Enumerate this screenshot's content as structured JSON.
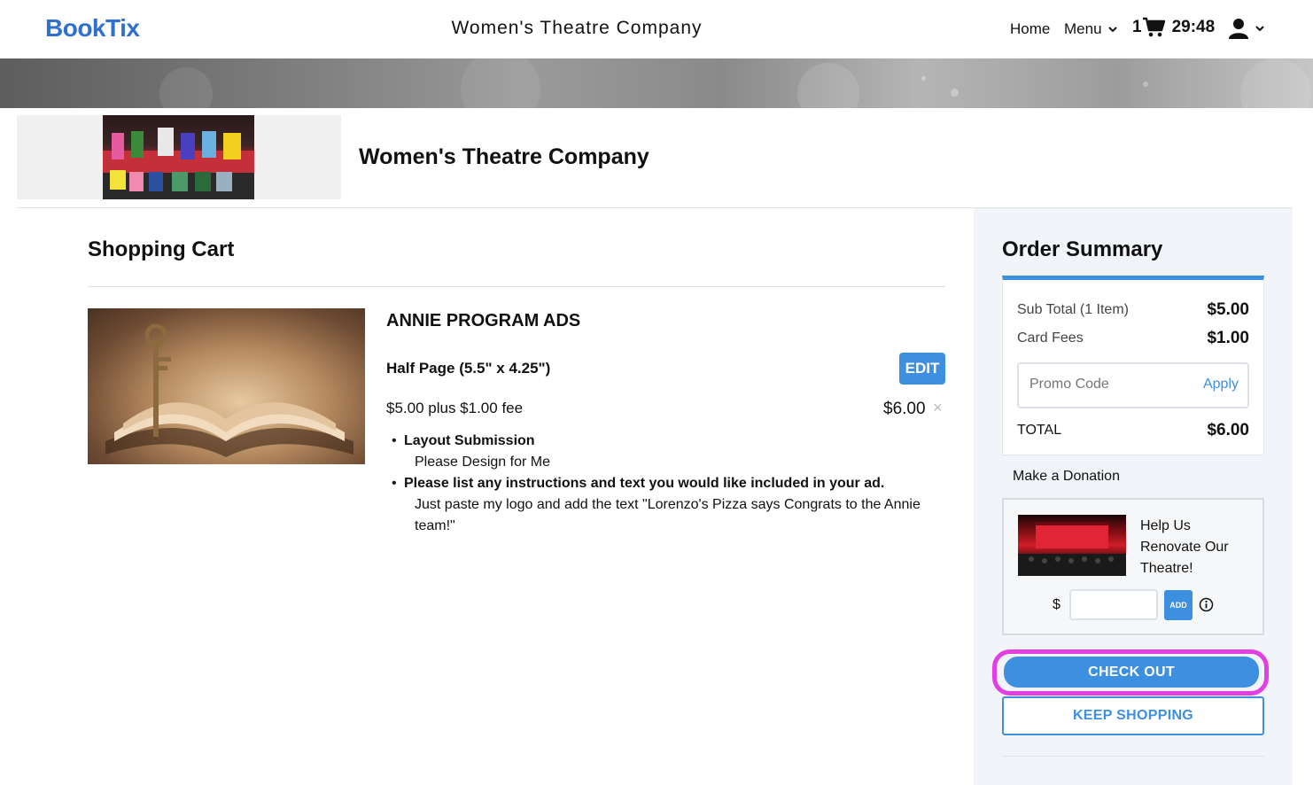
{
  "nav": {
    "logo": "BookTix",
    "title": "Women's Theatre Company",
    "home": "Home",
    "menu": "Menu",
    "cart_count": "1",
    "timer": "29:48"
  },
  "venue": {
    "name": "Women's Theatre Company"
  },
  "cart": {
    "title": "Shopping Cart",
    "item": {
      "name": "ANNIE PROGRAM ADS",
      "variant": "Half Page (5.5\" x 4.25\")",
      "edit_label": "EDIT",
      "price_desc": "$5.00 plus $1.00 fee",
      "total": "$6.00",
      "remove": "×",
      "options": [
        {
          "label": "Layout Submission",
          "value": "Please Design for Me"
        },
        {
          "label": "Please list any instructions and text you would like included in your ad.",
          "value": "Just paste my logo and add the text \"Lorenzo's Pizza says Congrats to the Annie team!\""
        }
      ]
    }
  },
  "summary": {
    "title": "Order Summary",
    "subtotal_label": "Sub Total (1 Item)",
    "subtotal_value": "$5.00",
    "fees_label": "Card Fees",
    "fees_value": "$1.00",
    "promo_placeholder": "Promo Code",
    "apply_label": "Apply",
    "total_label": "TOTAL",
    "total_value": "$6.00"
  },
  "donation": {
    "label": "Make a Donation",
    "text": "Help Us Renovate Our Theatre!",
    "currency": "$",
    "add_label": "ADD"
  },
  "actions": {
    "checkout": "CHECK OUT",
    "keep_shopping": "KEEP SHOPPING"
  },
  "colors": {
    "accent": "#3d8fe0",
    "logo": "#2f6fd0",
    "highlight": "#e23fe3"
  }
}
